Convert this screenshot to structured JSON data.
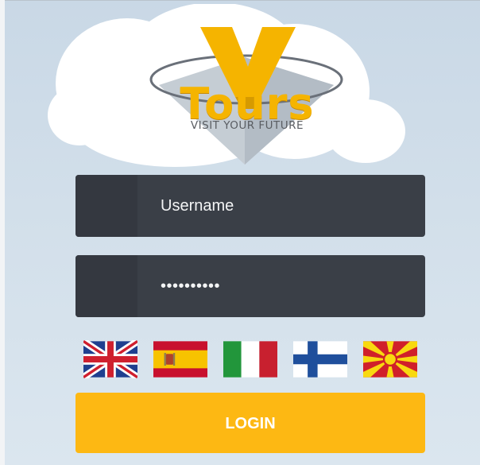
{
  "logo": {
    "wordmark": "Tours",
    "tagline": "VISIT YOUR FUTURE",
    "brand_color": "#f5b400"
  },
  "login_form": {
    "username": {
      "placeholder": "Username",
      "icon": "user-icon"
    },
    "password": {
      "value_masked": "••••••••••",
      "icon": "lock-icon"
    },
    "languages": [
      {
        "code": "en",
        "flag": "uk-flag-icon"
      },
      {
        "code": "es",
        "flag": "spain-flag-icon"
      },
      {
        "code": "it",
        "flag": "italy-flag-icon"
      },
      {
        "code": "fi",
        "flag": "finland-flag-icon"
      },
      {
        "code": "mk",
        "flag": "macedonia-flag-icon"
      }
    ],
    "login_label": "LOGIN"
  },
  "colors": {
    "field_background": "#3a3f47",
    "button_background": "#fdb813",
    "page_background": "#d2dfea"
  }
}
